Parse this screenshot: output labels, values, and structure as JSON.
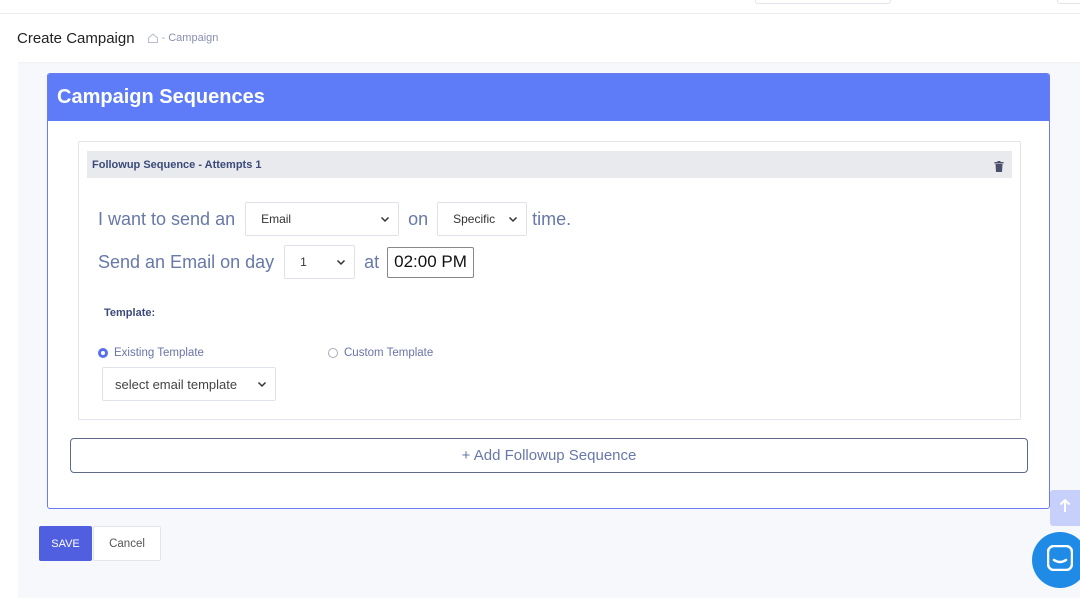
{
  "header": {
    "title": "Create Campaign",
    "breadcrumb_separator": "-",
    "breadcrumb_label": "Campaign"
  },
  "card": {
    "title": "Campaign Sequences"
  },
  "sequence": {
    "title": "Followup Sequence - Attempts 1",
    "sentence1_prefix": "I want to send an",
    "channel_value": "Email",
    "sentence1_middle": "on",
    "timing_value": "Specific",
    "sentence1_suffix": "time.",
    "sentence2_prefix": "Send an Email on day",
    "day_value": "1",
    "sentence2_middle": "at",
    "time_value": "02:00 PM",
    "template_label": "Template:",
    "radio_existing": "Existing Template",
    "radio_custom": "Custom Template",
    "template_select": "select email template"
  },
  "actions": {
    "add_followup": "+ Add Followup Sequence",
    "save": "SAVE",
    "cancel": "Cancel"
  },
  "colors": {
    "accent": "#5f7cf8",
    "primary_button": "#4f5fe0",
    "chat": "#1f8be6"
  }
}
